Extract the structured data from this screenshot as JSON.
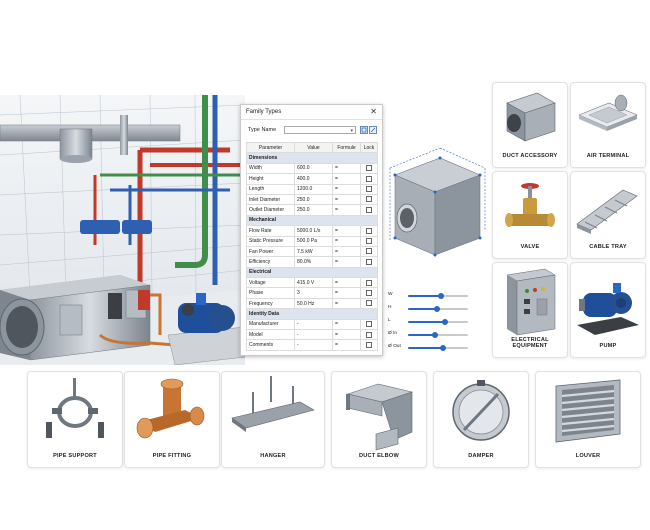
{
  "dialog": {
    "title": "Family Types",
    "type_name_label": "Type Name",
    "type_name_value": "",
    "columns": [
      "Parameter",
      "Value",
      "Formule",
      "Lock"
    ],
    "groups": [
      {
        "name": "Dimensions",
        "rows": [
          {
            "param": "Width",
            "value": "600.0",
            "formula": "="
          },
          {
            "param": "Height",
            "value": "400.0",
            "formula": "="
          },
          {
            "param": "Length",
            "value": "1200.0",
            "formula": "="
          },
          {
            "param": "Inlet Diameter",
            "value": "250.0",
            "formula": "="
          },
          {
            "param": "Outlet Diameter",
            "value": "250.0",
            "formula": "="
          }
        ]
      },
      {
        "name": "Mechanical",
        "rows": [
          {
            "param": "Flow Rate",
            "value": "5000.0 L/s",
            "formula": "="
          },
          {
            "param": "Static Pressure",
            "value": "500.0 Pa",
            "formula": "="
          },
          {
            "param": "Fan Power",
            "value": "7.5 kW",
            "formula": "="
          },
          {
            "param": "Efficiency",
            "value": "80.0%",
            "formula": "="
          }
        ]
      },
      {
        "name": "Electrical",
        "rows": [
          {
            "param": "Voltage",
            "value": "415.0 V",
            "formula": "="
          },
          {
            "param": "Phase",
            "value": "3",
            "formula": "="
          },
          {
            "param": "Frequency",
            "value": "50.0 Hz",
            "formula": "="
          }
        ]
      },
      {
        "name": "Identity Data",
        "rows": [
          {
            "param": "Manufacturer",
            "value": "-",
            "formula": "="
          },
          {
            "param": "Model",
            "value": "-",
            "formula": "="
          },
          {
            "param": "Comments",
            "value": "-",
            "formula": "="
          }
        ]
      }
    ]
  },
  "sliders": [
    {
      "label": "W",
      "level": 0.55
    },
    {
      "label": "H",
      "level": 0.48
    },
    {
      "label": "L",
      "level": 0.62
    },
    {
      "label": "Ø In",
      "level": 0.45
    },
    {
      "label": "Ø Out",
      "level": 0.58
    }
  ],
  "cards": {
    "duct_accessory": "DUCT ACCESSORY",
    "air_terminal": "AIR TERMINAL",
    "valve": "VALVE",
    "cable_tray": "CABLE TRAY",
    "electrical_equipment": "ELECTRICAL EQUIPMENT",
    "pump": "PUMP",
    "pipe_support": "PIPE SUPPORT",
    "pipe_fitting": "PIPE FITTING",
    "hanger": "HANGER",
    "duct_elbow": "DUCT ELBOW",
    "damper": "DAMPER",
    "louver": "LOUVER"
  },
  "colors": {
    "accent": "#2a66c8",
    "pipe_red": "#c0392b",
    "pipe_green": "#3f8f4a",
    "pipe_blue": "#2f5fb0",
    "pump_blue": "#1f4f9a",
    "copper": "#c87533"
  }
}
